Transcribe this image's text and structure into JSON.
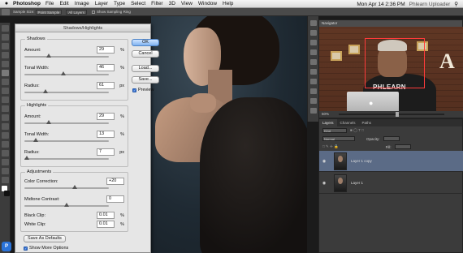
{
  "menubar": {
    "apple": "",
    "app": "Photoshop",
    "items": [
      "File",
      "Edit",
      "Image",
      "Layer",
      "Type",
      "Select",
      "Filter",
      "3D",
      "View",
      "Window",
      "Help"
    ],
    "clock": "Mon Apr 14  2:36 PM",
    "user": "Phlearn Uploader"
  },
  "options": {
    "sample_size_label": "Sample Size:",
    "sample_size_value": "Point Sample",
    "sample_value": "All Layers",
    "ring_label": "Show Sampling Ring"
  },
  "dialog": {
    "title": "Shadows/Highlights",
    "shadows": {
      "title": "Shadows",
      "amount": {
        "label": "Amount:",
        "value": "29",
        "unit": "%",
        "level": 0.29
      },
      "tonal": {
        "label": "Tonal Width:",
        "value": "46",
        "unit": "%",
        "level": 0.46
      },
      "radius": {
        "label": "Radius:",
        "value": "61",
        "unit": "px",
        "level": 0.25
      }
    },
    "highlights": {
      "title": "Highlights",
      "amount": {
        "label": "Amount:",
        "value": "29",
        "unit": "%",
        "level": 0.29
      },
      "tonal": {
        "label": "Tonal Width:",
        "value": "13",
        "unit": "%",
        "level": 0.13
      },
      "radius": {
        "label": "Radius:",
        "value": "7",
        "unit": "px",
        "level": 0.03
      }
    },
    "adjustments": {
      "title": "Adjustments",
      "color": {
        "label": "Color Correction:",
        "value": "+20",
        "level": 0.6
      },
      "midtone": {
        "label": "Midtone Contrast:",
        "value": "0",
        "level": 0.5
      },
      "black": {
        "label": "Black Clip:",
        "value": "0.01",
        "unit": "%"
      },
      "white": {
        "label": "White Clip:",
        "value": "0.01",
        "unit": "%"
      }
    },
    "buttons": {
      "ok": "OK",
      "cancel": "Cancel",
      "load": "Load...",
      "save": "Save..."
    },
    "preview_label": "Preview",
    "save_defaults": "Save As Defaults",
    "show_more": "Show More Options"
  },
  "navigator": {
    "title": "Navigator",
    "zoom": "50%",
    "sign": "PHLEARN",
    "letter": "A"
  },
  "layers": {
    "tabs": [
      "Layers",
      "Channels",
      "Paths"
    ],
    "kind": "Kind",
    "blend": "Normal",
    "opacity_label": "Opacity:",
    "fill_label": "Fill:",
    "items": [
      {
        "name": "Layer 1 copy",
        "selected": true
      },
      {
        "name": "Layer 1",
        "selected": false
      }
    ]
  }
}
